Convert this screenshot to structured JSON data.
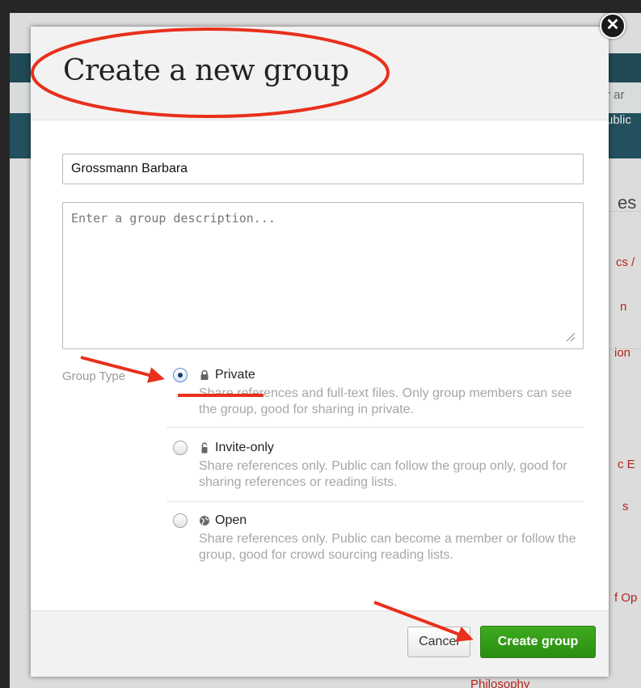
{
  "background": {
    "snippets": [
      "r ar",
      "ublic",
      "es",
      "cs /",
      "n",
      "ion",
      "c E",
      "s",
      "f Op",
      "Philosophy"
    ]
  },
  "modal": {
    "title": "Create a new group",
    "name_value": "Grossmann Barbara",
    "description_placeholder": "Enter a group description...",
    "group_type_label": "Group Type",
    "options": [
      {
        "icon": "lock-icon",
        "title": "Private",
        "description": "Share references and full-text files. Only group members can see the group, good for sharing in private.",
        "checked": true
      },
      {
        "icon": "padlock-open-icon",
        "title": "Invite-only",
        "description": "Share references only. Public can follow the group only, good for sharing references or reading lists.",
        "checked": false
      },
      {
        "icon": "globe-icon",
        "title": "Open",
        "description": "Share references only. Public can become a member or follow the group, good for crowd sourcing reading lists.",
        "checked": false
      }
    ],
    "cancel_label": "Cancel",
    "create_label": "Create group"
  },
  "colors": {
    "primary_button": "#2b8e12",
    "annotation_red": "#e8301c",
    "header_background": "#f2f2f2"
  }
}
